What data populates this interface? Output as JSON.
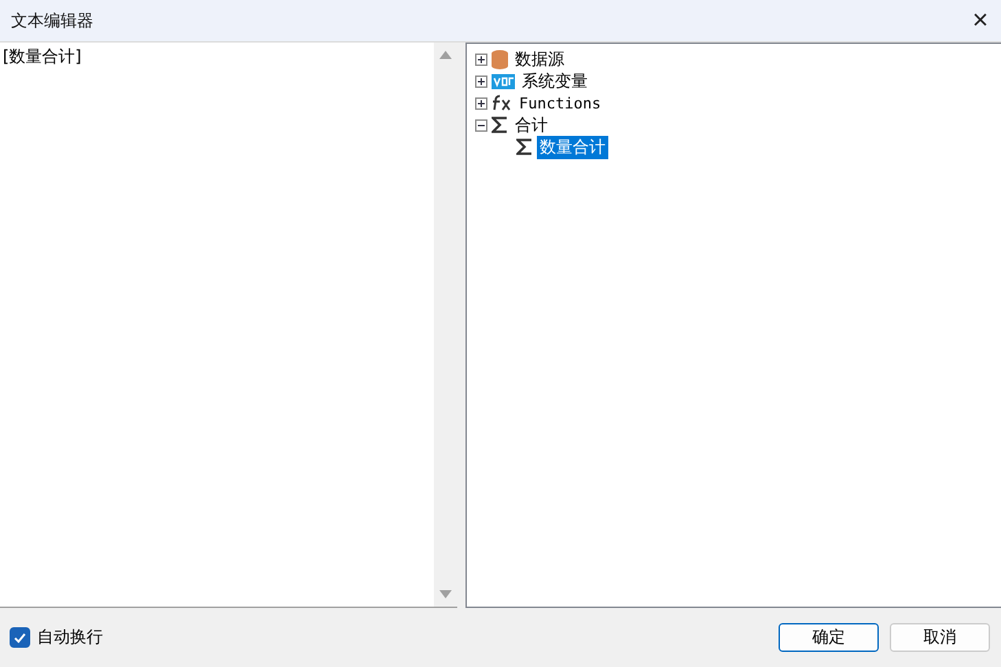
{
  "window": {
    "title": "文本编辑器",
    "close": "×"
  },
  "editor": {
    "value": "[数量合计]"
  },
  "tree": [
    {
      "label": "数据源",
      "kind": "database",
      "expanded": false,
      "selected": false
    },
    {
      "label": "系统变量",
      "kind": "var",
      "expanded": false,
      "selected": false
    },
    {
      "label": "Functions",
      "kind": "fx",
      "expanded": false,
      "selected": false
    },
    {
      "label": "合计",
      "kind": "sigma",
      "expanded": true,
      "selected": false,
      "children": [
        {
          "label": "数量合计",
          "kind": "sigma",
          "selected": true
        }
      ]
    }
  ],
  "word_wrap": {
    "label": "自动换行",
    "checked": true
  },
  "buttons": [
    {
      "label": "确定",
      "kind": "primary"
    },
    {
      "label": "取消",
      "kind": "normal"
    }
  ]
}
